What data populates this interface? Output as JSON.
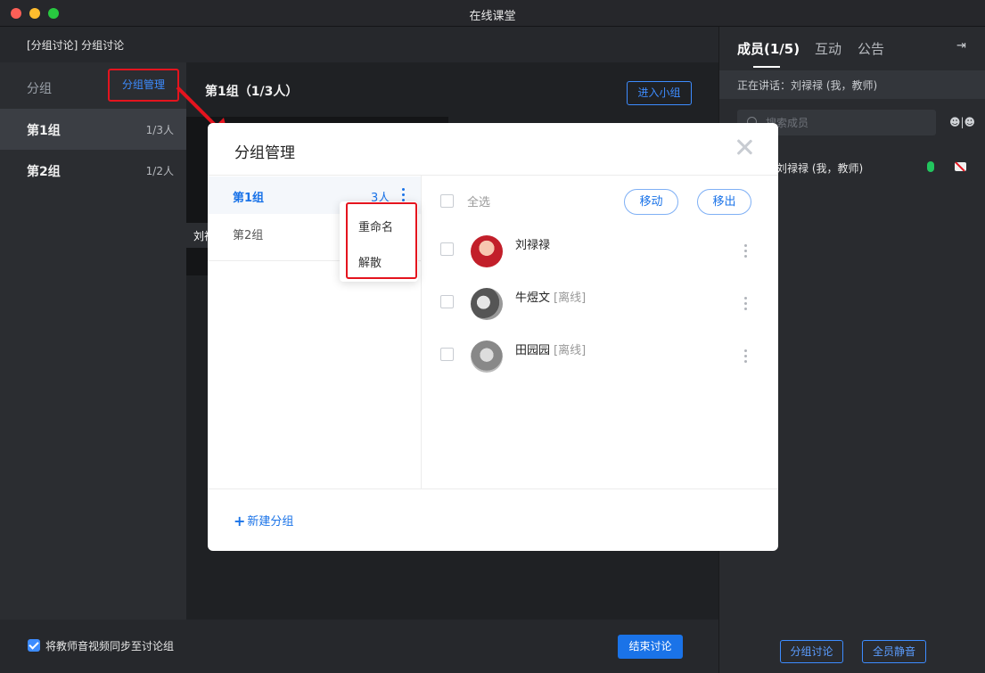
{
  "window": {
    "title": "在线课堂"
  },
  "main": {
    "breadcrumb": "[分组讨论] 分组讨论",
    "sidebar": {
      "header_label": "分组",
      "manage_link": "分组管理",
      "groups": [
        {
          "name": "第1组",
          "count": "1/3人"
        },
        {
          "name": "第2组",
          "count": "1/2人"
        }
      ]
    },
    "video": {
      "title": "第1组（1/3人）",
      "enter_group_button": "进入小组",
      "tile_label": "刘禄"
    },
    "bottom": {
      "sync_label": "将教师音视频同步至讨论组",
      "end_discussion_button": "结束讨论"
    }
  },
  "right_panel": {
    "tabs": [
      {
        "label": "成员(1/5)"
      },
      {
        "label": "互动"
      },
      {
        "label": "公告"
      }
    ],
    "speaking_text": "正在讲话：刘禄禄 (我，教师)",
    "search": {
      "placeholder": "搜索成员"
    },
    "member": {
      "name": "刘禄禄 (我，教师)"
    },
    "group_discussion_button": "分组讨论",
    "mute_all_button": "全员静音"
  },
  "modal": {
    "title": "分组管理",
    "groups": [
      {
        "name": "第1组",
        "count": "3人"
      },
      {
        "name": "第2组"
      }
    ],
    "context_menu": [
      "重命名",
      "解散"
    ],
    "select_all_label": "全选",
    "move_button": "移动",
    "remove_button": "移出",
    "members": [
      {
        "name": "刘禄禄",
        "status": ""
      },
      {
        "name": "牛煜文",
        "status": "[离线]"
      },
      {
        "name": "田园园",
        "status": "[离线]"
      }
    ],
    "new_group_button": "新建分组"
  },
  "colors": {
    "accent": "#1a73e8",
    "annotation_red": "#e4141e",
    "mic_green": "#22c55e"
  }
}
